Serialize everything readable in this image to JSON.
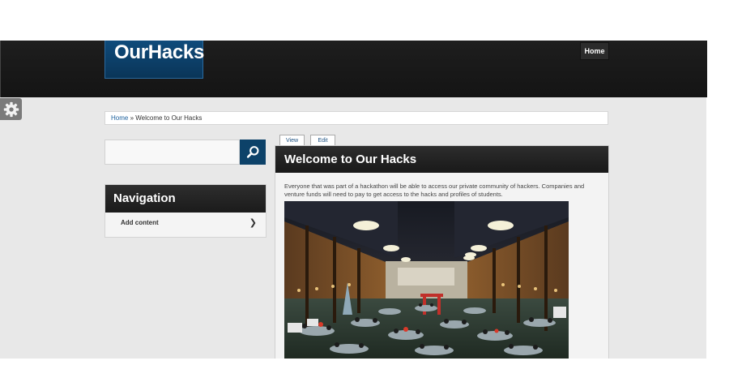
{
  "site": {
    "logo_text": "OurHacks"
  },
  "menu": {
    "home_label": "Home"
  },
  "breadcrumb": {
    "home": "Home",
    "separator": " » ",
    "current": "Welcome to Our Hacks"
  },
  "sidebar": {
    "search": {
      "placeholder": ""
    },
    "navigation": {
      "title": "Navigation",
      "items": [
        {
          "label": "Add content",
          "arrow": "❯"
        }
      ]
    }
  },
  "tabs": [
    {
      "label": "View"
    },
    {
      "label": "Edit"
    }
  ],
  "page": {
    "title": "Welcome to Our Hacks",
    "body": "Everyone that was part of a hackathon will be able to access our private community of hackers. Companies and venture funds will need to pay to get access to the hacks and profiles of students."
  },
  "colors": {
    "brand": "#0f4b7b",
    "header": "#1a1a1a",
    "background": "#e8e8e8"
  },
  "icons": {
    "gear": "gear-icon",
    "search": "search-icon"
  }
}
